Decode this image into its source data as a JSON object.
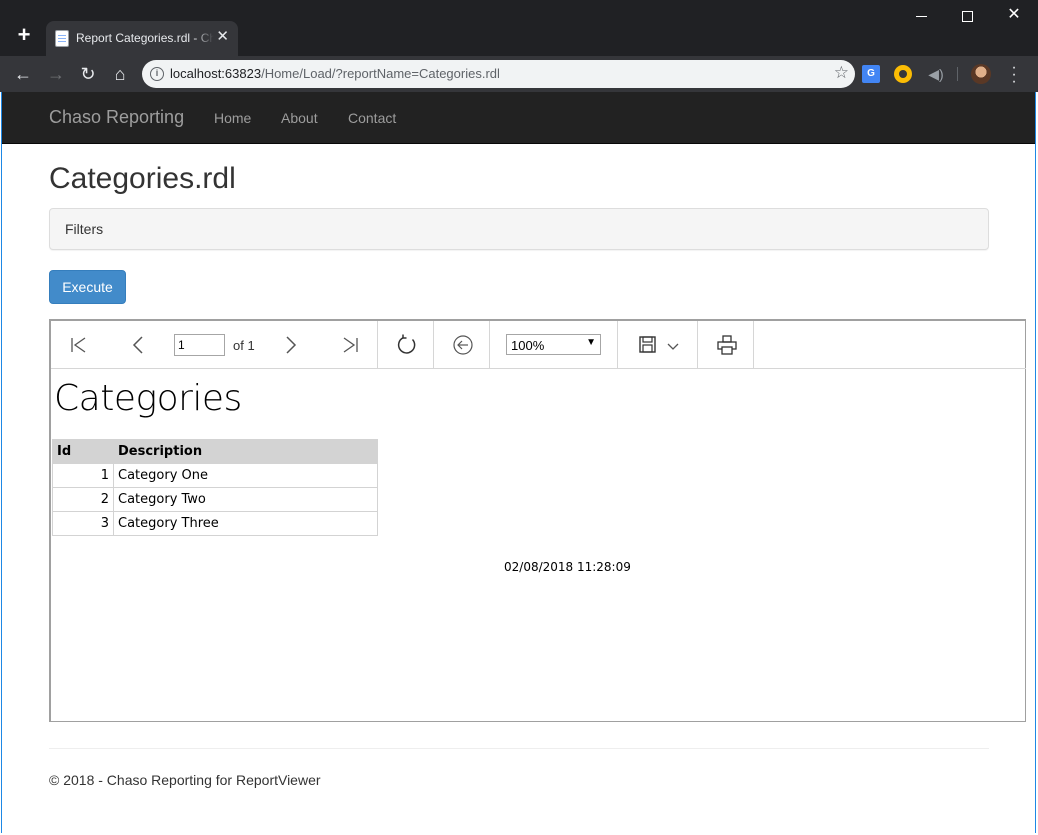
{
  "browser": {
    "tab_title": "Report Categories.rdl - Chaso Reporting",
    "url_host": "localhost:63823",
    "url_path": "/Home/Load/?reportName=Categories.rdl",
    "icons": [
      "new-tab-icon",
      "close-icon",
      "back-icon",
      "forward-icon",
      "reload-icon",
      "home-icon",
      "info-icon",
      "star-icon",
      "translate-icon",
      "menu-icon"
    ]
  },
  "navbar": {
    "brand": "Chaso Reporting",
    "links": [
      "Home",
      "About",
      "Contact"
    ]
  },
  "page": {
    "title": "Categories.rdl",
    "filters_label": "Filters",
    "execute_label": "Execute"
  },
  "viewer": {
    "page_number": "1",
    "of_label": "of 1",
    "zoom": "100%"
  },
  "report": {
    "title": "Categories",
    "columns": [
      "Id",
      "Description"
    ],
    "rows": [
      {
        "id": "1",
        "description": "Category One"
      },
      {
        "id": "2",
        "description": "Category Two"
      },
      {
        "id": "3",
        "description": "Category Three"
      }
    ],
    "timestamp": "02/08/2018 11:28:09"
  },
  "footer": {
    "text": "© 2018 - Chaso Reporting for ReportViewer"
  },
  "colors": {
    "navbar_bg": "#222222",
    "primary": "#428bca",
    "header_cell": "#d3d3d3"
  }
}
